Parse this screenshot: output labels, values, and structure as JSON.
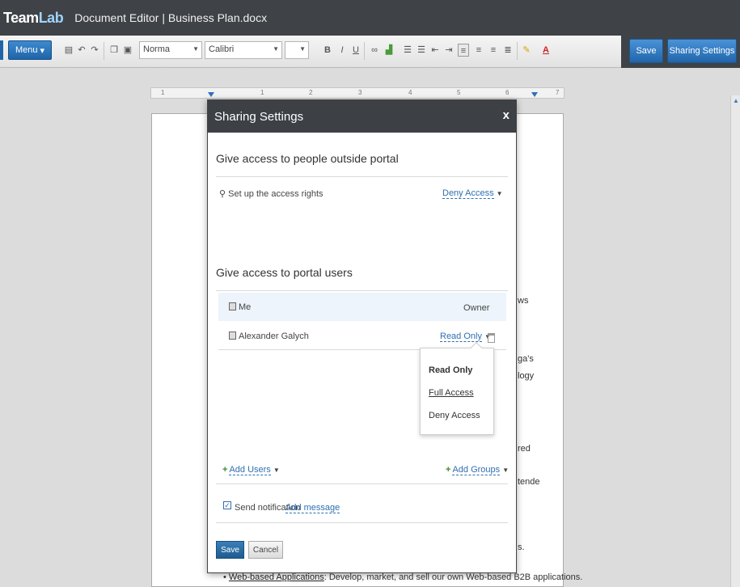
{
  "app": {
    "logo_team": "Team",
    "logo_lab": "Lab",
    "title": "Document Editor | Business Plan.docx"
  },
  "toolbar": {
    "menu_label": "Menu",
    "style_value": "Norma",
    "font_value": "Calibri",
    "size_value": "",
    "bold": "B",
    "italic": "I",
    "underline": "U",
    "save_label": "Save",
    "sharing_label": "Sharing Settings"
  },
  "ruler": {
    "marks": [
      "1",
      "1",
      "2",
      "3",
      "4",
      "5",
      "6",
      "7"
    ]
  },
  "document": {
    "fragments": [
      "ws",
      "ga's",
      "logy",
      "red",
      "tende",
      "s."
    ],
    "bullet_link": "Web-based Applications",
    "bullet_text": ": Develop, market, and sell our own Web-based B2B applications."
  },
  "dialog": {
    "title": "Sharing Settings",
    "close": "x",
    "outside_title": "Give access to people outside portal",
    "setup_label": "Set up the access rights",
    "deny_access": "Deny Access",
    "portal_title": "Give access to portal users",
    "owner_name": "Me",
    "owner_role": "Owner",
    "user_name": "Alexander Galych",
    "user_access": "Read Only",
    "dropdown": {
      "read_only": "Read Only",
      "full_access": "Full Access",
      "deny_access": "Deny Access"
    },
    "add_users": "Add Users",
    "add_groups": "Add Groups",
    "notification_label": "Send notification",
    "add_message": "Add message",
    "save_label": "Save",
    "cancel_label": "Cancel"
  }
}
